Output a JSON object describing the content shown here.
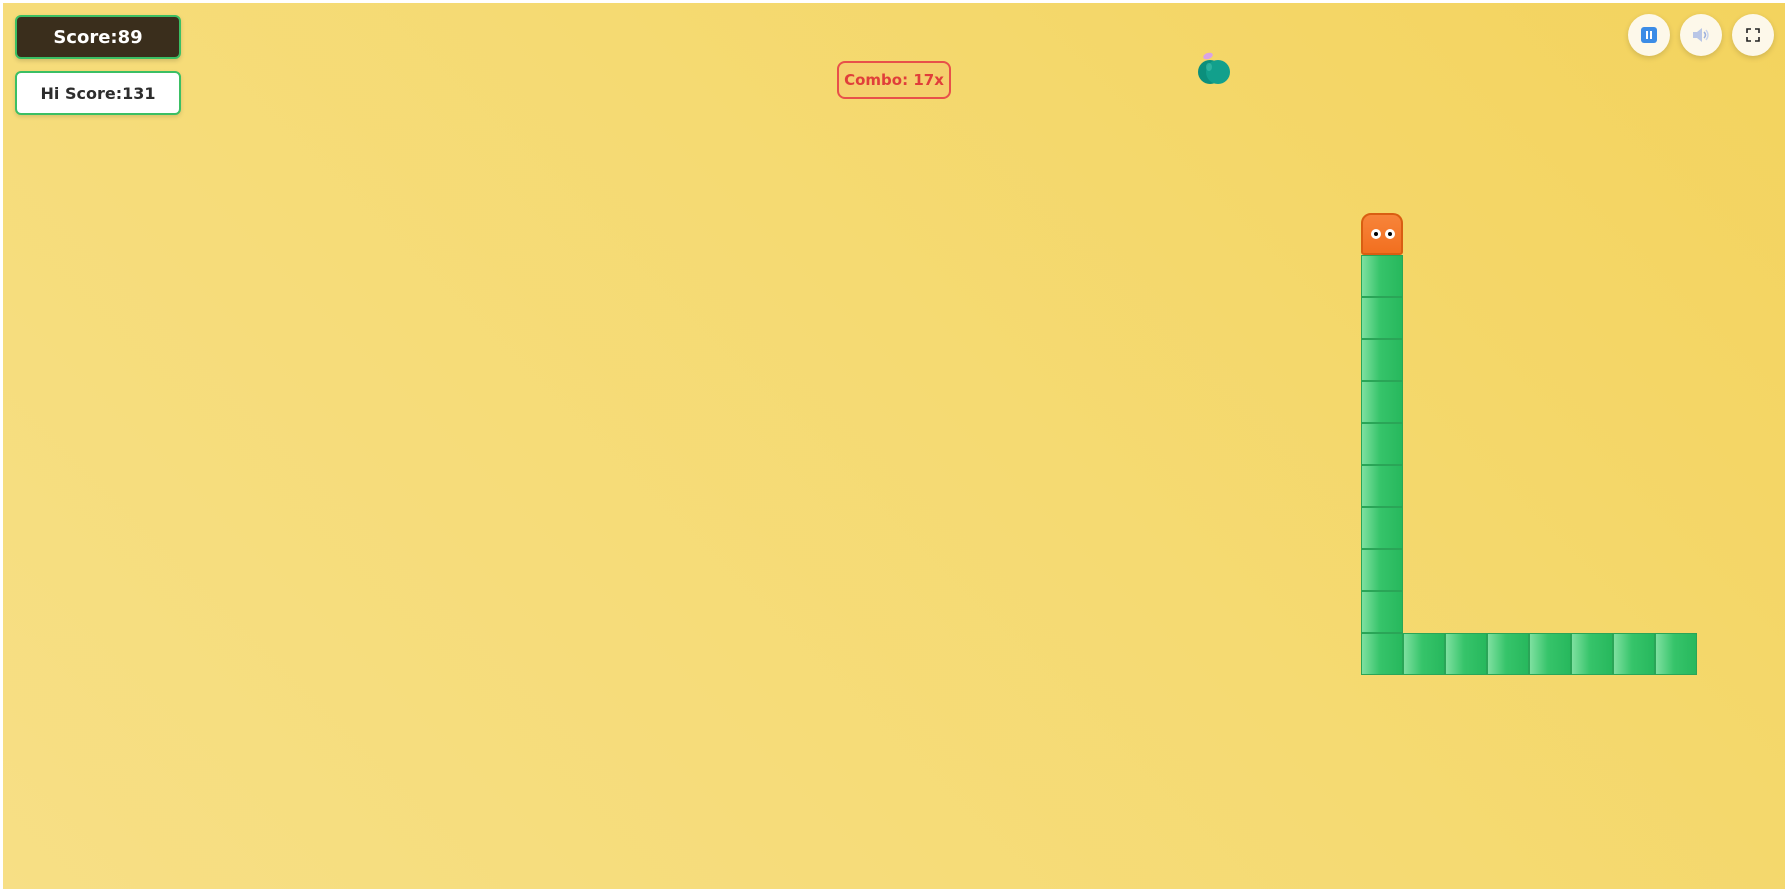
{
  "hud": {
    "score_text": "Score:89",
    "hiscore_text": "Hi Score:131",
    "combo_text": "Combo: 17x"
  },
  "controls": {
    "pause_icon": "pause-icon",
    "sound_icon": "speaker-icon",
    "fullscreen_icon": "fullscreen-icon"
  },
  "colors": {
    "background": "#f5d96e",
    "snake_body": "#36c46a",
    "snake_head": "#f26f1f",
    "score_bg": "#3a2e1c",
    "combo_text": "#e03e3a",
    "fruit": "#0e9a86"
  },
  "game": {
    "snake_direction": "up",
    "snake_length": 19,
    "fruit_type": "teal-apple"
  }
}
